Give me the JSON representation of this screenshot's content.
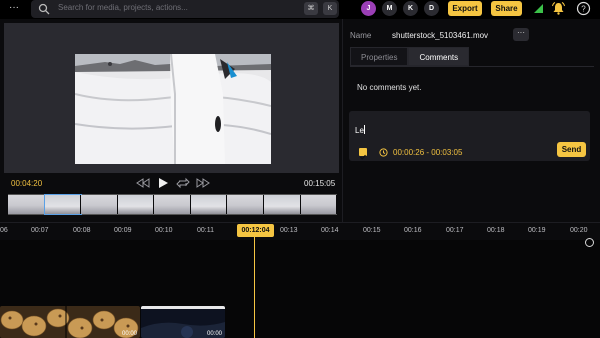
{
  "topbar": {
    "more_label": "···",
    "search_placeholder": "Search for media, projects, actions...",
    "shortcut_keys": [
      "⌘",
      "K"
    ],
    "avatars": [
      "J",
      "M",
      "K",
      "D"
    ],
    "export_label": "Export",
    "share_label": "Share",
    "accent_color": "#f5c542",
    "avatar_j_color": "#9b3fb6"
  },
  "player": {
    "current_time": "00:04:20",
    "duration": "00:15:05"
  },
  "inspector": {
    "name_label": "Name",
    "file_name": "shutterstock_5103461.mov",
    "more_label": "···",
    "tabs": [
      {
        "label": "Properties",
        "active": false
      },
      {
        "label": "Comments",
        "active": true
      }
    ],
    "empty_state": "No comments yet.",
    "composer_text": "Le",
    "range": "00:00:26 - 00:03:05",
    "send_label": "Send"
  },
  "timeline": {
    "ticks": [
      "06",
      "00:07",
      "00:08",
      "00:09",
      "00:10",
      "00:11",
      "00:12:04",
      "00:13",
      "00:14",
      "00:15",
      "00:16",
      "00:17",
      "00:18",
      "00:19",
      "00:20"
    ],
    "playhead": "00:12:04",
    "clips": [
      {
        "label": "00:00"
      },
      {
        "label": "00:00"
      }
    ]
  }
}
